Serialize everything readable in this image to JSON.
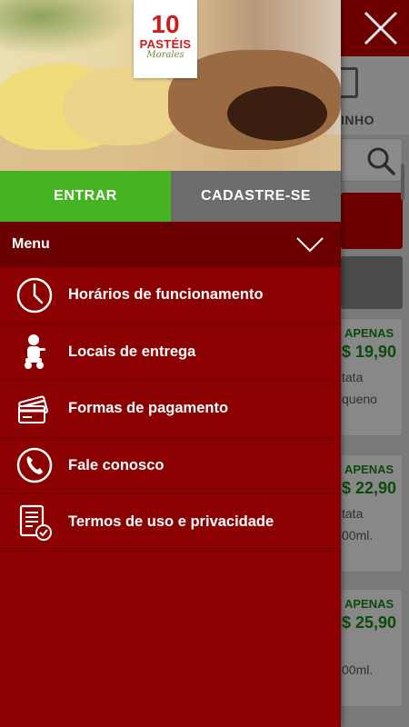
{
  "drawer": {
    "logo": {
      "number": "10",
      "word": "PASTÉIS",
      "script": "Morales"
    },
    "auth": {
      "login_label": "ENTRAR",
      "signup_label": "CADASTRE-SE"
    },
    "menu_title": "Menu",
    "menu_items": [
      {
        "label": "Horários de funcionamento",
        "icon": "clock-icon"
      },
      {
        "label": "Locais de entrega",
        "icon": "delivery-person-icon"
      },
      {
        "label": "Formas de pagamento",
        "icon": "credit-card-icon"
      },
      {
        "label": "Fale conosco",
        "icon": "phone-icon"
      },
      {
        "label": "Termos de uso e privacidade",
        "icon": "document-check-icon"
      }
    ]
  },
  "background": {
    "tab_label": "INHO",
    "cards": [
      {
        "apenas": "APENAS",
        "price": "$ 19,90",
        "desc1": "tata",
        "desc2": "queno"
      },
      {
        "apenas": "APENAS",
        "price": "$ 22,90",
        "desc1": "tata",
        "desc2": "00ml."
      },
      {
        "apenas": "APENAS",
        "price": "$ 25,90",
        "desc1": "",
        "desc2": "00ml."
      }
    ]
  },
  "colors": {
    "drawer_red": "#8b0000",
    "header_dark_red": "#6a0000",
    "login_green": "#46b321",
    "signup_grey": "#6c6c6c",
    "price_green": "#0c4a0c"
  }
}
